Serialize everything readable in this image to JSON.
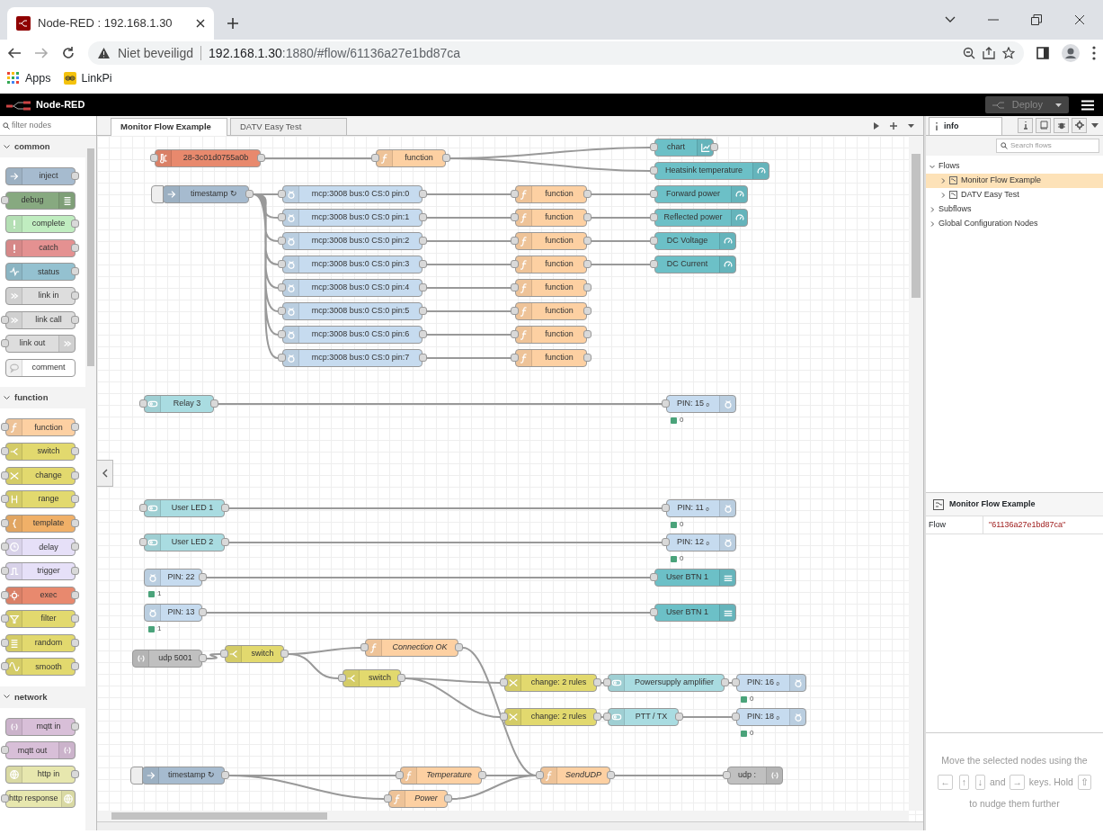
{
  "browser": {
    "tab_title": "Node-RED : 192.168.1.30",
    "security": "Niet beveiligd",
    "url_host": "192.168.1.30",
    "url_rest": ":1880/#flow/61136a27e1bd87ca",
    "bookmarks": [
      "Apps",
      "LinkPi"
    ]
  },
  "header": {
    "app_name": "Node-RED",
    "deploy": "Deploy",
    "deploy_disabled": true
  },
  "palette": {
    "filter_placeholder": "filter nodes",
    "categories": [
      {
        "name": "common",
        "expanded": true,
        "nodes": [
          {
            "kind": "inject",
            "label": "inject"
          },
          {
            "kind": "debug",
            "label": "debug"
          },
          {
            "kind": "complete",
            "label": "complete"
          },
          {
            "kind": "catch",
            "label": "catch"
          },
          {
            "kind": "status",
            "label": "status"
          },
          {
            "kind": "linkin",
            "label": "link in"
          },
          {
            "kind": "linkcall",
            "label": "link call"
          },
          {
            "kind": "linkout",
            "label": "link out"
          },
          {
            "kind": "comment",
            "label": "comment"
          }
        ]
      },
      {
        "name": "function",
        "expanded": true,
        "nodes": [
          {
            "kind": "function",
            "label": "function"
          },
          {
            "kind": "switch",
            "label": "switch"
          },
          {
            "kind": "change",
            "label": "change"
          },
          {
            "kind": "range",
            "label": "range"
          },
          {
            "kind": "template",
            "label": "template"
          },
          {
            "kind": "delay",
            "label": "delay"
          },
          {
            "kind": "trigger",
            "label": "trigger"
          },
          {
            "kind": "exec",
            "label": "exec"
          },
          {
            "kind": "filter",
            "label": "filter"
          },
          {
            "kind": "random",
            "label": "random"
          },
          {
            "kind": "smooth",
            "label": "smooth"
          }
        ]
      },
      {
        "name": "network",
        "expanded": true,
        "nodes": [
          {
            "kind": "mqttin",
            "label": "mqtt in"
          },
          {
            "kind": "mqttout",
            "label": "mqtt out"
          },
          {
            "kind": "httpin",
            "label": "http in"
          },
          {
            "kind": "httpresp",
            "label": "http response"
          }
        ]
      }
    ]
  },
  "flow_tabs": [
    {
      "label": "Monitor Flow Example",
      "selected": true
    },
    {
      "label": "DATV Easy Test",
      "selected": false
    }
  ],
  "nodes": [
    {
      "kind": "sensor",
      "label": "28-3c01d0755a0b",
      "named": false
    },
    {
      "kind": "function",
      "label": "function",
      "named": false
    },
    {
      "kind": "chart",
      "label": "chart",
      "named": false
    },
    {
      "kind": "gauge",
      "label": "Heatsink temperature",
      "named": false
    },
    {
      "kind": "inject",
      "label": "timestamp ↻",
      "named": false
    },
    {
      "kind": "mcp",
      "label": "mcp:3008 bus:0 CS:0 pin:0",
      "named": false
    },
    {
      "kind": "mcp",
      "label": "mcp:3008 bus:0 CS:0 pin:1",
      "named": false
    },
    {
      "kind": "mcp",
      "label": "mcp:3008 bus:0 CS:0 pin:2",
      "named": false
    },
    {
      "kind": "mcp",
      "label": "mcp:3008 bus:0 CS:0 pin:3",
      "named": false
    },
    {
      "kind": "mcp",
      "label": "mcp:3008 bus:0 CS:0 pin:4",
      "named": false
    },
    {
      "kind": "mcp",
      "label": "mcp:3008 bus:0 CS:0 pin:5",
      "named": false
    },
    {
      "kind": "mcp",
      "label": "mcp:3008 bus:0 CS:0 pin:6",
      "named": false
    },
    {
      "kind": "mcp",
      "label": "mcp:3008 bus:0 CS:0 pin:7",
      "named": false
    },
    {
      "kind": "function",
      "label": "function",
      "named": false
    },
    {
      "kind": "function",
      "label": "function",
      "named": false
    },
    {
      "kind": "function",
      "label": "function",
      "named": false
    },
    {
      "kind": "function",
      "label": "function",
      "named": false
    },
    {
      "kind": "function",
      "label": "function",
      "named": false
    },
    {
      "kind": "function",
      "label": "function",
      "named": false
    },
    {
      "kind": "function",
      "label": "function",
      "named": false
    },
    {
      "kind": "function",
      "label": "function",
      "named": false
    },
    {
      "kind": "gauge",
      "label": "Forward power",
      "named": false
    },
    {
      "kind": "gauge",
      "label": "Reflected power",
      "named": false
    },
    {
      "kind": "gauge",
      "label": "DC Voltage",
      "named": false
    },
    {
      "kind": "gauge",
      "label": "DC Current",
      "named": false
    },
    {
      "kind": "dswitch",
      "label": "Relay 3",
      "named": false
    },
    {
      "kind": "rpiout",
      "label": "PIN: 15 ₒ",
      "named": false,
      "status": "0"
    },
    {
      "kind": "dswitch",
      "label": "User LED 1",
      "named": false
    },
    {
      "kind": "rpiout",
      "label": "PIN: 11 ₒ",
      "named": false,
      "status": "0"
    },
    {
      "kind": "dswitch",
      "label": "User LED 2",
      "named": false
    },
    {
      "kind": "rpiout",
      "label": "PIN: 12 ₒ",
      "named": false,
      "status": "0"
    },
    {
      "kind": "rpiin",
      "label": "PIN: 22",
      "named": false,
      "status": "1"
    },
    {
      "kind": "textui",
      "label": "User BTN 1",
      "named": false
    },
    {
      "kind": "rpiin",
      "label": "PIN: 13",
      "named": false,
      "status": "1"
    },
    {
      "kind": "textui",
      "label": "User BTN 1",
      "named": false
    },
    {
      "kind": "udpin",
      "label": "udp 5001",
      "named": false
    },
    {
      "kind": "switch",
      "label": "switch",
      "named": false
    },
    {
      "kind": "function",
      "label": "Connection OK",
      "named": true
    },
    {
      "kind": "switch",
      "label": "switch",
      "named": false
    },
    {
      "kind": "change",
      "label": "change: 2 rules",
      "named": false
    },
    {
      "kind": "dswitch",
      "label": "Powersupply amplifier",
      "named": false
    },
    {
      "kind": "rpiout",
      "label": "PIN: 16 ₒ",
      "named": false,
      "status": "0"
    },
    {
      "kind": "change",
      "label": "change: 2 rules",
      "named": false
    },
    {
      "kind": "dswitch",
      "label": "PTT / TX",
      "named": false
    },
    {
      "kind": "rpiout",
      "label": "PIN: 18 ₒ",
      "named": false,
      "status": "0"
    },
    {
      "kind": "inject",
      "label": "timestamp ↻",
      "named": false
    },
    {
      "kind": "function",
      "label": "Temperature",
      "named": true
    },
    {
      "kind": "function",
      "label": "Power",
      "named": true
    },
    {
      "kind": "function",
      "label": "SendUDP",
      "named": true
    },
    {
      "kind": "udpout",
      "label": "udp :",
      "named": false
    }
  ],
  "sidebar": {
    "tab": "info",
    "search_placeholder": "Search flows",
    "tree": [
      {
        "label": "Flows",
        "expanded": true,
        "children": [
          {
            "label": "Monitor Flow Example",
            "selected": true
          },
          {
            "label": "DATV Easy Test",
            "selected": false
          }
        ]
      },
      {
        "label": "Subflows",
        "expanded": false
      },
      {
        "label": "Global Configuration Nodes",
        "expanded": false
      }
    ],
    "info_title": "Monitor Flow Example",
    "properties": [
      {
        "name": "Flow",
        "value": "\"61136a27e1bd87ca\""
      }
    ],
    "tip": [
      {
        "kind": "text",
        "text": "Move the selected nodes using the"
      },
      {
        "kind": "key",
        "text": "←"
      },
      {
        "kind": "key",
        "text": "↑"
      },
      {
        "kind": "key",
        "text": "↓"
      },
      {
        "kind": "text",
        "text": "and"
      },
      {
        "kind": "key",
        "text": "→"
      },
      {
        "kind": "text",
        "text": "keys. Hold"
      },
      {
        "kind": "key",
        "text": "⇧"
      },
      {
        "kind": "text",
        "text": "to nudge them further"
      }
    ]
  }
}
